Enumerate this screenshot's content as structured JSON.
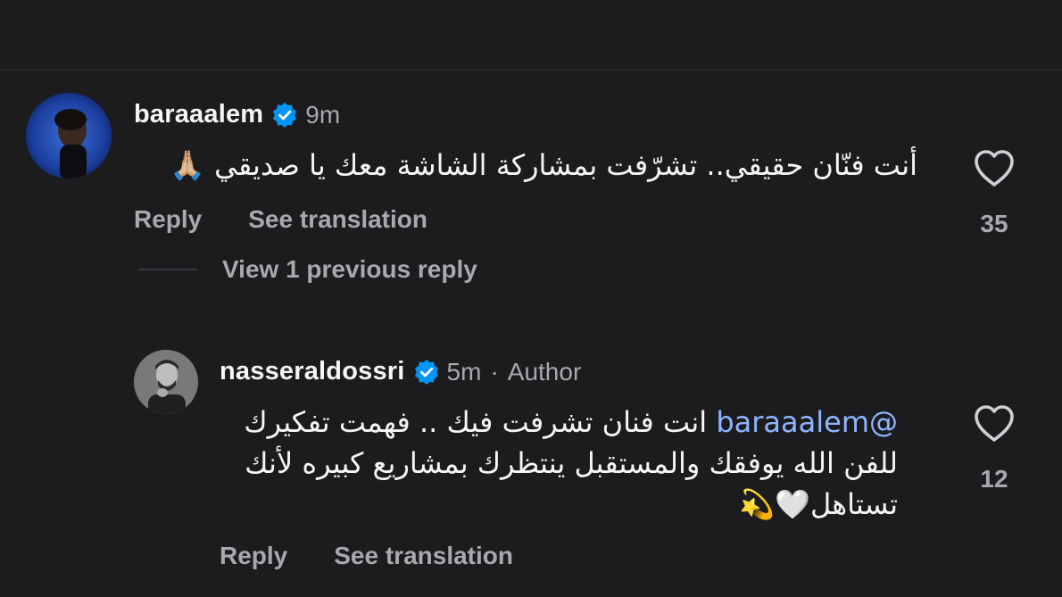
{
  "comments": [
    {
      "username": "baraaalem",
      "verified": true,
      "time": "9m",
      "text": "أنت فنّان حقيقي.. تشرّفت بمشاركة الشاشة معك يا صديقي 🙏🏼",
      "reply_label": "Reply",
      "translate_label": "See translation",
      "likes": "35"
    },
    {
      "username": "nasseraldossri",
      "verified": true,
      "time": "5m",
      "separator": "·",
      "author_label": "Author",
      "mention": "@baraaalem",
      "text": "انت فنان تشرفت فيك .. فهمت تفكيرك للفن الله يوفقك والمستقبل ينتظرك بمشاريع كبيره لأنك تستاهل🤍💫",
      "reply_label": "Reply",
      "translate_label": "See translation",
      "likes": "12"
    }
  ],
  "view_replies": "View 1 previous reply",
  "colors": {
    "background": "#1c1c1f",
    "verified": "#0095f6",
    "mention": "#8fb4ff",
    "muted": "#a8a8ad"
  },
  "icons": [
    "verified-badge-icon",
    "heart-outline-icon"
  ]
}
